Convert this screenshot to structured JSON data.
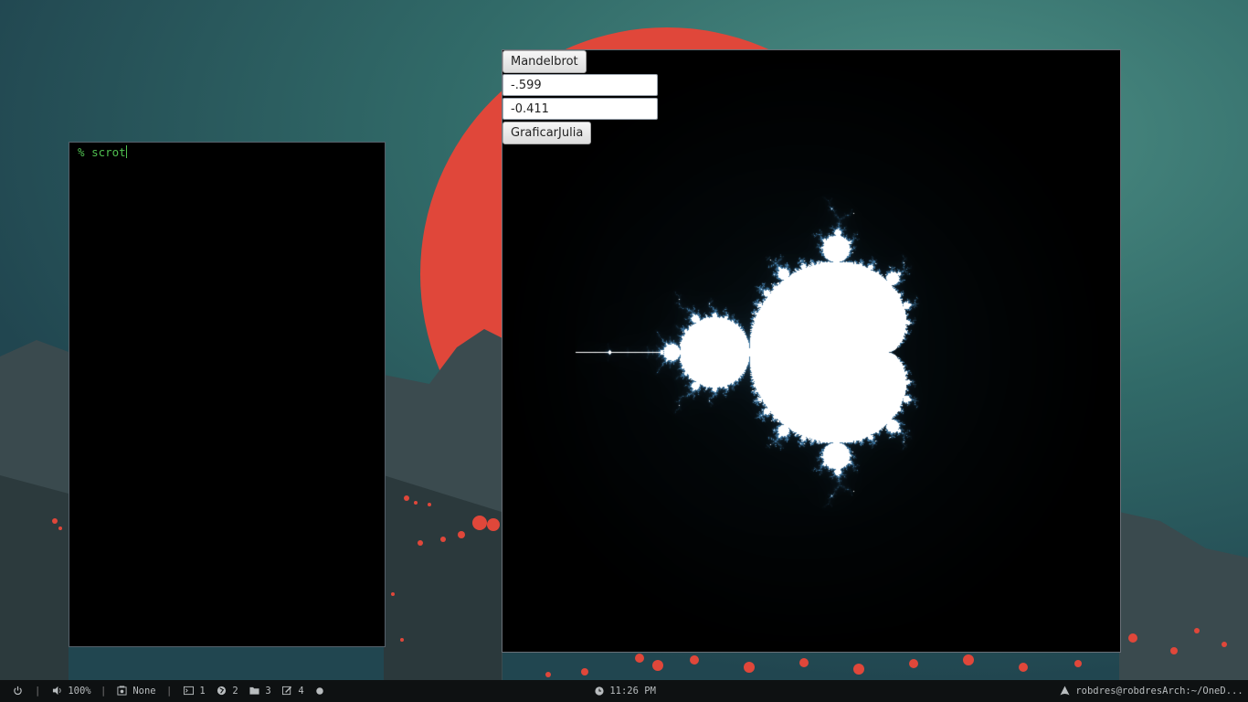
{
  "terminal": {
    "prompt": "%",
    "command": "scrot"
  },
  "fractal_app": {
    "mandelbrot_button_label": "Mandelbrot",
    "real_input_value": "-.599",
    "imag_input_value": "-0.411",
    "julia_button_label": "GraficarJulia"
  },
  "statusbar": {
    "separator": "|",
    "volume": "100%",
    "media": "None",
    "workspaces": [
      "1",
      "2",
      "3",
      "4"
    ],
    "clock": "11:26 PM",
    "window_title": "robdres@robdresArch:~/OneD..."
  },
  "colors": {
    "terminal_text": "#4fbf4f",
    "sun": "#e0473a",
    "statusbar_bg": "#0e1112"
  },
  "icons": {
    "power": "power-icon",
    "volume": "speaker-icon",
    "media": "music-player-icon",
    "workspace1": "terminal-icon",
    "workspace2": "web-icon",
    "workspace3": "folder-icon",
    "workspace4": "edit-icon",
    "workspace5": "circle-icon",
    "clock": "clock-icon",
    "window": "arch-icon"
  }
}
